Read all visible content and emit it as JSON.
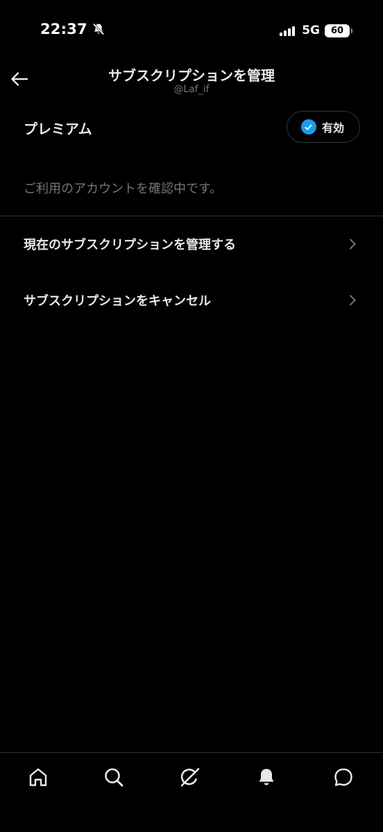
{
  "status_bar": {
    "time": "22:37",
    "network": "5G",
    "battery": "60",
    "icons": [
      "bell-off-icon",
      "signal-icon",
      "battery-icon"
    ]
  },
  "header": {
    "back_icon": "arrow-left-icon",
    "title": "サブスクリプションを管理",
    "handle": "@Laf_if"
  },
  "premium": {
    "label": "プレミアム",
    "status_label": "有効",
    "status_icon": "check-circle-icon",
    "accent": "#1d9bf0"
  },
  "info": {
    "text": "ご利用のアカウントを確認中です。"
  },
  "menu": [
    {
      "label": "現在のサブスクリプションを管理する",
      "icon": "chevron-right-icon"
    },
    {
      "label": "サブスクリプションをキャンセル",
      "icon": "chevron-right-icon"
    }
  ],
  "bottom_nav": [
    {
      "name": "home",
      "icon": "home-icon"
    },
    {
      "name": "search",
      "icon": "search-icon"
    },
    {
      "name": "grok",
      "icon": "grok-icon"
    },
    {
      "name": "notifications",
      "icon": "bell-icon"
    },
    {
      "name": "messages",
      "icon": "message-icon"
    }
  ],
  "colors": {
    "background": "#000000",
    "primary_text": "#e7e9ea",
    "secondary_text": "#71767b",
    "divider": "#2f3336"
  }
}
